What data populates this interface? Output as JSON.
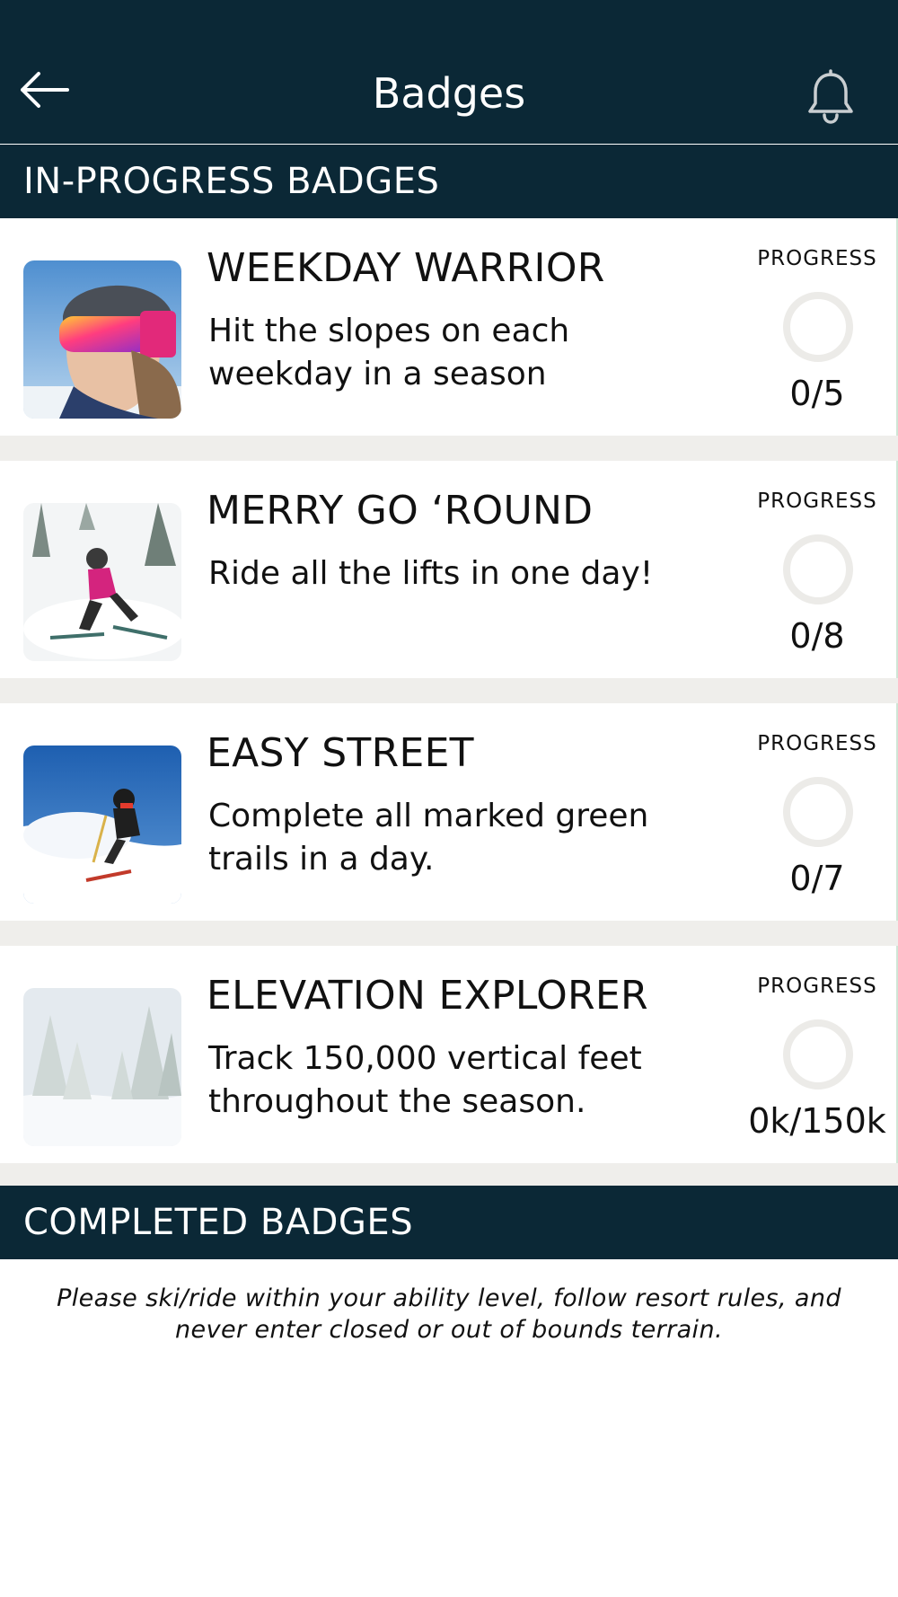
{
  "header": {
    "title": "Badges",
    "back_icon": "arrow-left-icon",
    "notification_icon": "bell-icon",
    "background_color": "#0b2836"
  },
  "sections": {
    "in_progress_label": "IN-PROGRESS BADGES",
    "completed_label": "COMPLETED BADGES"
  },
  "badges": [
    {
      "title": "WEEKDAY WARRIOR",
      "description": "Hit the slopes on each weekday in a season",
      "progress_label": "PROGRESS",
      "progress_value": "0/5",
      "progress_fraction": 0
    },
    {
      "title": "MERRY GO ‘ROUND",
      "description": "Ride all the lifts in one day!",
      "progress_label": "PROGRESS",
      "progress_value": "0/8",
      "progress_fraction": 0
    },
    {
      "title": "EASY STREET",
      "description": "Complete all marked green trails in a day.",
      "progress_label": "PROGRESS",
      "progress_value": "0/7",
      "progress_fraction": 0
    },
    {
      "title": "ELEVATION EXPLORER",
      "description": "Track 150,000 vertical feet throughout the season.",
      "progress_label": "PROGRESS",
      "progress_value": "0k/150k",
      "progress_fraction": 0
    }
  ],
  "disclaimer": "Please ski/ride within your ability level, follow resort rules, and never enter closed or out of bounds terrain."
}
